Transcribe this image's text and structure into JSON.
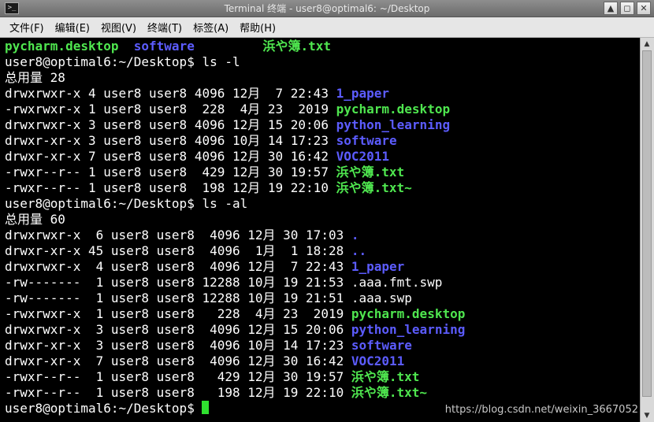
{
  "window": {
    "title": "Terminal 终端 - user8@optimal6: ~/Desktop",
    "app_icon_text": ">_",
    "buttons": {
      "up": "▲",
      "restore": "◻",
      "close": "✕"
    }
  },
  "menu": [
    "文件(F)",
    "编辑(E)",
    "视图(V)",
    "终端(T)",
    "标签(A)",
    "帮助(H)"
  ],
  "terminal": {
    "lines": [
      [
        [
          "pycharm.desktop",
          "g"
        ],
        [
          "  ",
          ""
        ],
        [
          "software",
          "b"
        ],
        [
          "         ",
          ""
        ],
        [
          "浜や簿.txt",
          "g"
        ]
      ],
      [
        [
          "user8@optimal6:~/Desktop$ ls -l",
          ""
        ]
      ],
      [
        [
          "总用量 28",
          ""
        ]
      ],
      [
        [
          "drwxrwxr-x 4 user8 user8 4096 12月  7 22:43 ",
          ""
        ],
        [
          "1_paper",
          "b"
        ]
      ],
      [
        [
          "-rwxrwxr-x 1 user8 user8  228  4月 23  2019 ",
          ""
        ],
        [
          "pycharm.desktop",
          "g"
        ]
      ],
      [
        [
          "drwxrwxr-x 3 user8 user8 4096 12月 15 20:06 ",
          ""
        ],
        [
          "python_learning",
          "b"
        ]
      ],
      [
        [
          "drwxr-xr-x 3 user8 user8 4096 10月 14 17:23 ",
          ""
        ],
        [
          "software",
          "b"
        ]
      ],
      [
        [
          "drwxr-xr-x 7 user8 user8 4096 12月 30 16:42 ",
          ""
        ],
        [
          "VOC2011",
          "b"
        ]
      ],
      [
        [
          "-rwxr--r-- 1 user8 user8  429 12月 30 19:57 ",
          ""
        ],
        [
          "浜や簿.txt",
          "g"
        ]
      ],
      [
        [
          "-rwxr--r-- 1 user8 user8  198 12月 19 22:10 ",
          ""
        ],
        [
          "浜や簿.txt~",
          "g"
        ]
      ],
      [
        [
          "user8@optimal6:~/Desktop$ ls -al",
          ""
        ]
      ],
      [
        [
          "总用量 60",
          ""
        ]
      ],
      [
        [
          "drwxrwxr-x  6 user8 user8  4096 12月 30 17:03 ",
          ""
        ],
        [
          ".",
          "b"
        ]
      ],
      [
        [
          "drwxr-xr-x 45 user8 user8  4096  1月  1 18:28 ",
          ""
        ],
        [
          "..",
          "b"
        ]
      ],
      [
        [
          "drwxrwxr-x  4 user8 user8  4096 12月  7 22:43 ",
          ""
        ],
        [
          "1_paper",
          "b"
        ]
      ],
      [
        [
          "-rw-------  1 user8 user8 12288 10月 19 21:53 .aaa.fmt.swp",
          ""
        ]
      ],
      [
        [
          "-rw-------  1 user8 user8 12288 10月 19 21:51 .aaa.swp",
          ""
        ]
      ],
      [
        [
          "-rwxrwxr-x  1 user8 user8   228  4月 23  2019 ",
          ""
        ],
        [
          "pycharm.desktop",
          "g"
        ]
      ],
      [
        [
          "drwxrwxr-x  3 user8 user8  4096 12月 15 20:06 ",
          ""
        ],
        [
          "python_learning",
          "b"
        ]
      ],
      [
        [
          "drwxr-xr-x  3 user8 user8  4096 10月 14 17:23 ",
          ""
        ],
        [
          "software",
          "b"
        ]
      ],
      [
        [
          "drwxr-xr-x  7 user8 user8  4096 12月 30 16:42 ",
          ""
        ],
        [
          "VOC2011",
          "b"
        ]
      ],
      [
        [
          "-rwxr--r--  1 user8 user8   429 12月 30 19:57 ",
          ""
        ],
        [
          "浜や簿.txt",
          "g"
        ]
      ],
      [
        [
          "-rwxr--r--  1 user8 user8   198 12月 19 22:10 ",
          ""
        ],
        [
          "浜や簿.txt~",
          "g"
        ]
      ],
      [
        [
          "user8@optimal6:~/Desktop$ ",
          ""
        ]
      ]
    ],
    "colors": {
      "green": "#4fe64f",
      "blue": "#5c5cff",
      "text": "#ffffff",
      "background": "#000000",
      "cursor": "#2fe02f"
    }
  },
  "scrollbar": {
    "up": "▲",
    "down": "▼"
  },
  "watermark": "https://blog.csdn.net/weixin_3667052"
}
